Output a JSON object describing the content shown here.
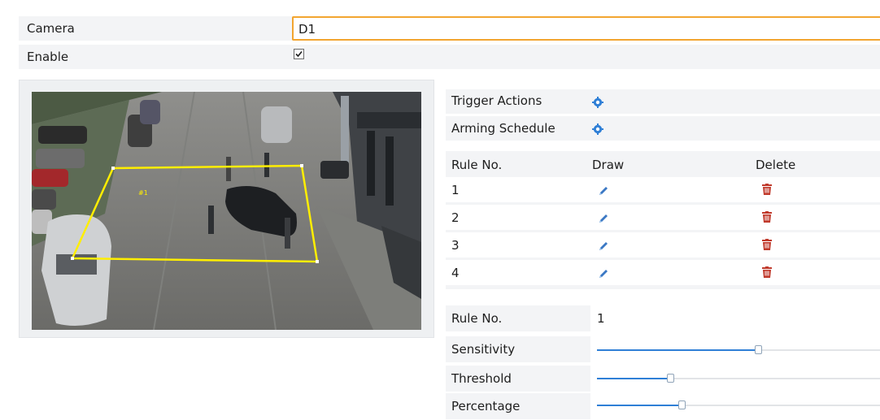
{
  "form": {
    "camera_label": "Camera",
    "camera_value": "D1",
    "enable_label": "Enable",
    "enable_checked": true
  },
  "preview": {
    "region_label": "#1"
  },
  "actions": {
    "trigger_label": "Trigger Actions",
    "arming_label": "Arming Schedule",
    "icon": "gear-icon"
  },
  "rules_table": {
    "headers": [
      "Rule No.",
      "Draw",
      "Delete"
    ],
    "rows": [
      {
        "no": "1",
        "draw_icon": "pencil-icon",
        "delete_icon": "trash-icon"
      },
      {
        "no": "2",
        "draw_icon": "pencil-icon",
        "delete_icon": "trash-icon"
      },
      {
        "no": "3",
        "draw_icon": "pencil-icon",
        "delete_icon": "trash-icon"
      },
      {
        "no": "4",
        "draw_icon": "pencil-icon",
        "delete_icon": "trash-icon"
      }
    ]
  },
  "settings": {
    "rule_no_label": "Rule No.",
    "rule_no_value": "1",
    "sliders": [
      {
        "label": "Sensitivity",
        "level": 0.57
      },
      {
        "label": "Threshold",
        "level": 0.26
      },
      {
        "label": "Percentage",
        "level": 0.3
      }
    ]
  },
  "colors": {
    "accent_orange": "#f2a530",
    "slider_blue": "#2f7fd6",
    "trash_red": "#c0392b",
    "region_yellow": "#ffee00"
  }
}
